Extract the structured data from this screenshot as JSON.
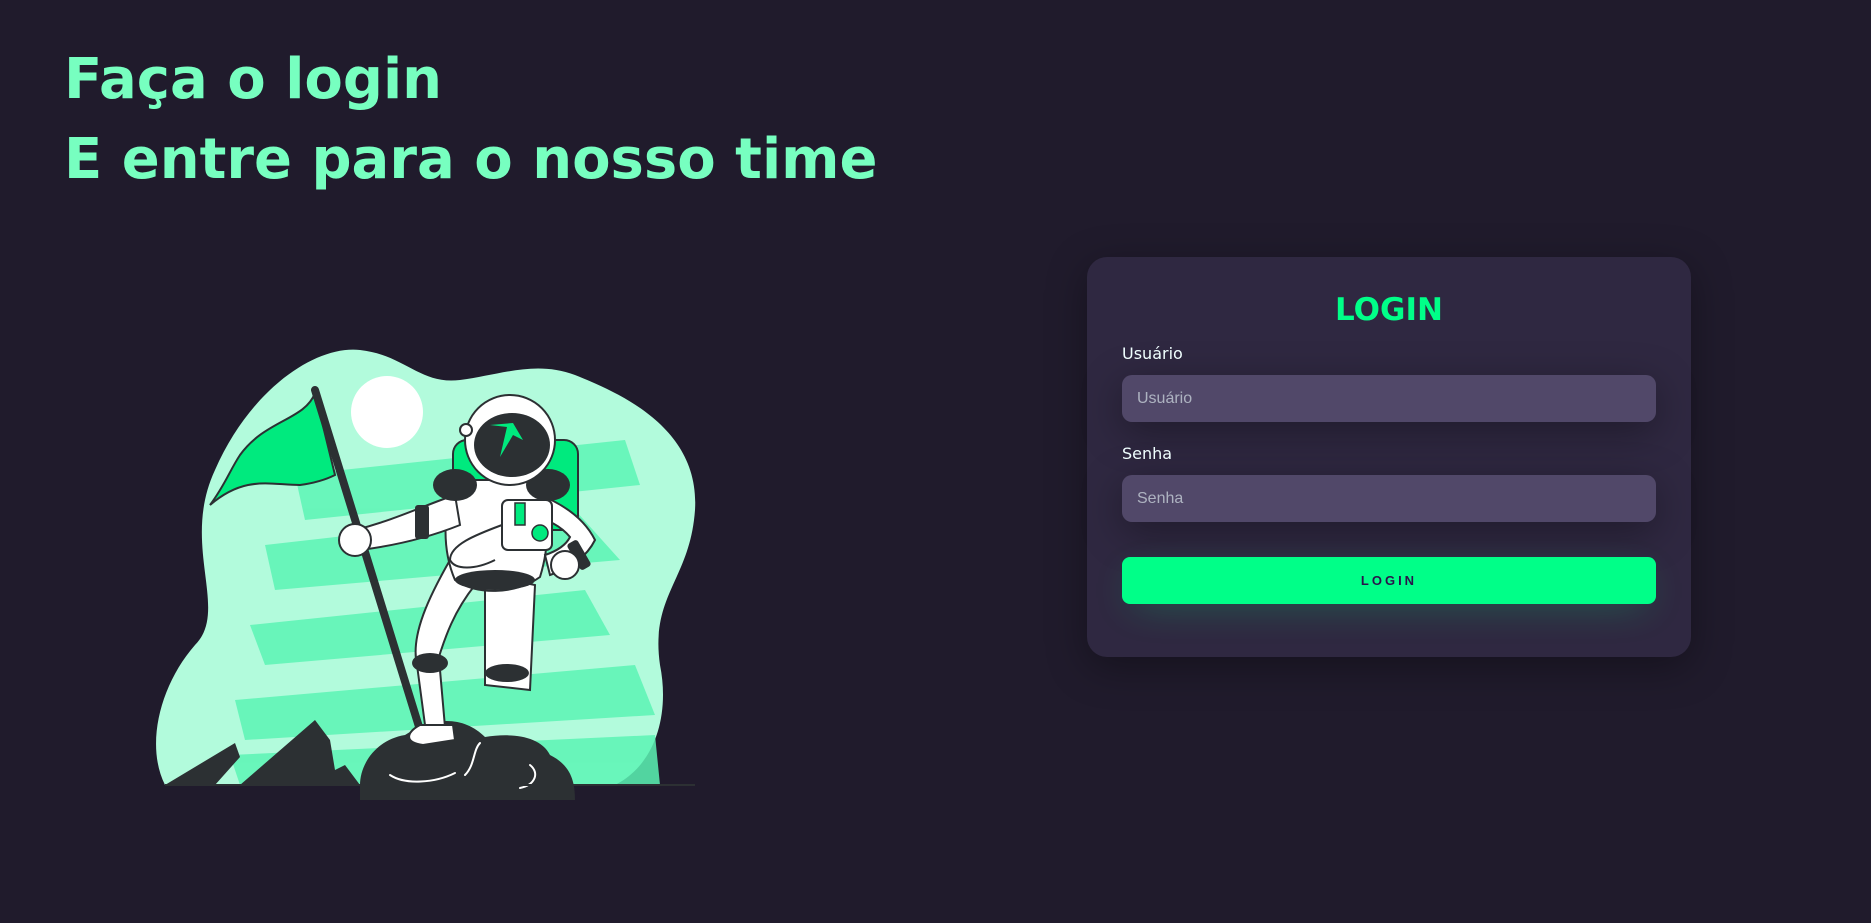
{
  "headline": {
    "line1": "Faça o login",
    "line2": "E entre para o nosso time"
  },
  "login_card": {
    "title": "LOGIN",
    "username": {
      "label": "Usuário",
      "placeholder": "Usuário",
      "value": ""
    },
    "password": {
      "label": "Senha",
      "placeholder": "Senha",
      "value": ""
    },
    "submit_label": "LOGIN"
  },
  "colors": {
    "background": "#201b2c",
    "headline": "#77ffc0",
    "accent": "#00ff88",
    "card": "#2f2841",
    "input": "#514869",
    "illustration_light": "#b2fbdc",
    "illustration_dark": "#2c3033"
  },
  "illustration": {
    "subject": "astronaut-with-flag-illustration"
  }
}
